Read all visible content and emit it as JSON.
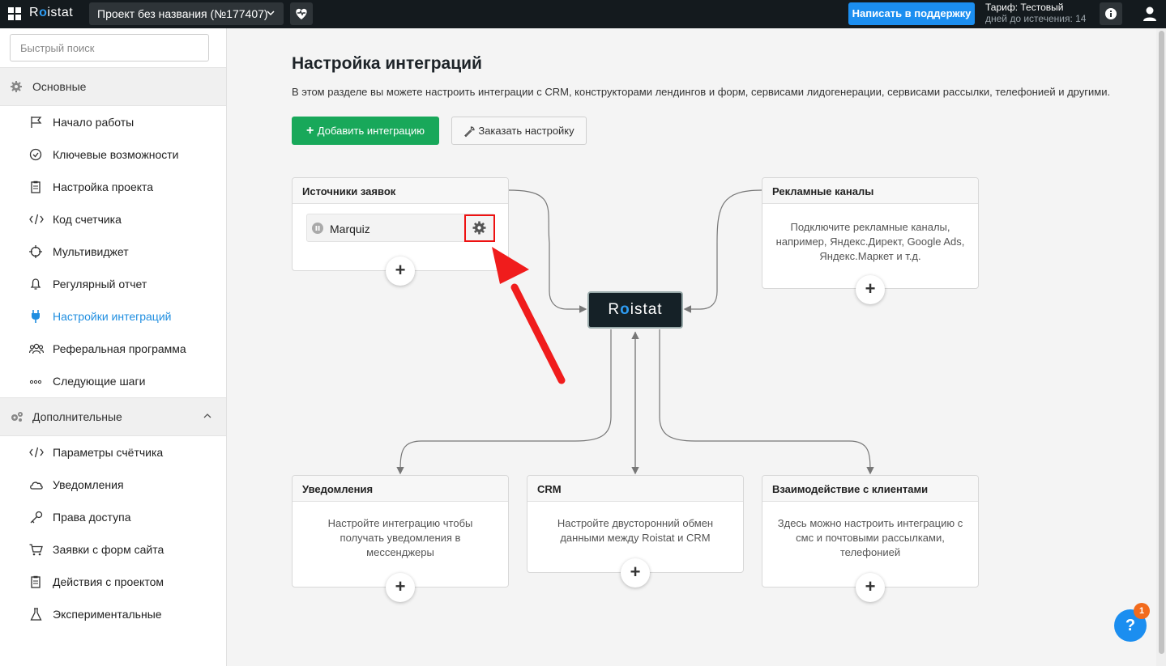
{
  "topbar": {
    "logo_pre": "R",
    "logo_o": "o",
    "logo_post": "istat",
    "project_name": "Проект без названия (№177407)",
    "support_label": "Написать в поддержку",
    "tariff_line1": "Тариф: Тестовый",
    "tariff_line2": "дней до истечения: 14"
  },
  "sidebar": {
    "search_placeholder": "Быстрый поиск",
    "main_section": "Основные",
    "main_items": [
      {
        "label": "Начало работы",
        "icon": "flag-icon"
      },
      {
        "label": "Ключевые возможности",
        "icon": "check-circle-icon"
      },
      {
        "label": "Настройка проекта",
        "icon": "clipboard-icon"
      },
      {
        "label": "Код счетчика",
        "icon": "code-icon"
      },
      {
        "label": "Мультивиджет",
        "icon": "crosshair-icon"
      },
      {
        "label": "Регулярный отчет",
        "icon": "bell-icon"
      },
      {
        "label": "Настройки интеграций",
        "icon": "plug-icon"
      },
      {
        "label": "Реферальная программа",
        "icon": "users-icon"
      },
      {
        "label": "Следующие шаги",
        "icon": "dots-icon"
      }
    ],
    "extra_section": "Дополнительные",
    "extra_items": [
      {
        "label": "Параметры счётчика",
        "icon": "code-icon"
      },
      {
        "label": "Уведомления",
        "icon": "cloud-icon"
      },
      {
        "label": "Права доступа",
        "icon": "key-icon"
      },
      {
        "label": "Заявки с форм сайта",
        "icon": "cart-icon"
      },
      {
        "label": "Действия с проектом",
        "icon": "clipboard-icon"
      },
      {
        "label": "Экспериментальные",
        "icon": "flask-icon"
      }
    ],
    "active_color": "#1f8ee0"
  },
  "main": {
    "title": "Настройка интеграций",
    "description": "В этом разделе вы можете настроить интеграции с CRM, конструкторами лендингов и форм, сервисами лидогенерации, сервисами рассылки, телефонией и другими.",
    "add_button": "Добавить интеграцию",
    "order_button": "Заказать настройку"
  },
  "diagram": {
    "sources": {
      "title": "Источники заявок",
      "item": "Marquiz"
    },
    "ads": {
      "title": "Рекламные каналы",
      "text": "Подключите рекламные каналы, например, Яндекс.Директ, Google Ads, Яндекс.Маркет и т.д."
    },
    "hub": {
      "pre": "R",
      "o": "o",
      "post": "istat"
    },
    "notifications": {
      "title": "Уведомления",
      "text": "Настройте интеграцию чтобы получать уведомления в мессенджеры"
    },
    "crm": {
      "title": "CRM",
      "text": "Настройте двусторонний обмен данными между Roistat и CRM"
    },
    "clients": {
      "title": "Взаимодействие с клиентами",
      "text": "Здесь можно настроить интеграцию с смс и почтовыми рассылками, телефонией"
    },
    "plus": "+"
  },
  "help": {
    "label": "?",
    "badge": "1"
  },
  "colors": {
    "primary": "#1b8ef0",
    "green": "#18a85a",
    "highlight": "#e11111",
    "topbar": "#141a1e"
  }
}
